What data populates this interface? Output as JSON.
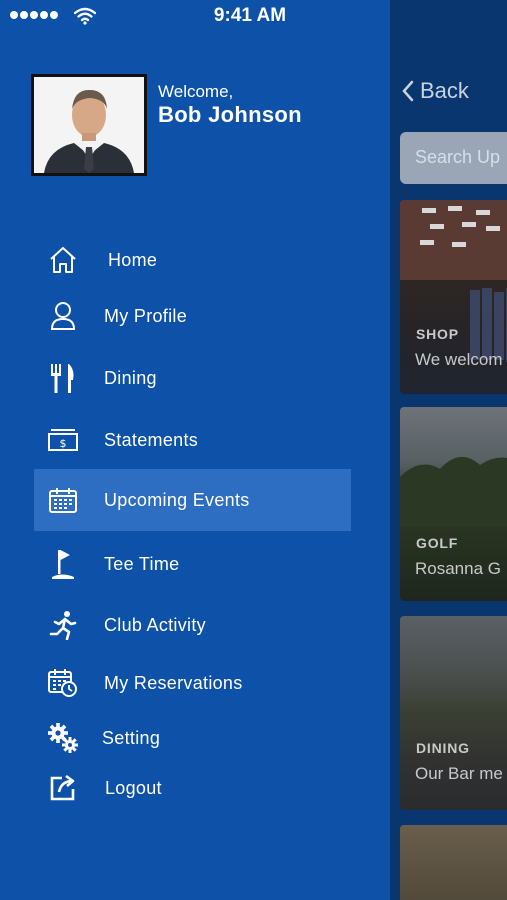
{
  "status_bar": {
    "time": "9:41 AM"
  },
  "profile": {
    "welcome": "Welcome,",
    "name": "Bob Johnson"
  },
  "menu": [
    {
      "label": "Home",
      "icon": "home-icon"
    },
    {
      "label": "My Profile",
      "icon": "user-icon"
    },
    {
      "label": "Dining",
      "icon": "fork-knife-icon"
    },
    {
      "label": "Statements",
      "icon": "bill-icon"
    },
    {
      "label": "Upcoming Events",
      "icon": "calendar-icon",
      "active": true
    },
    {
      "label": "Tee Time",
      "icon": "golf-flag-icon"
    },
    {
      "label": "Club Activity",
      "icon": "runner-icon"
    },
    {
      "label": "My Reservations",
      "icon": "calendar-clock-icon"
    },
    {
      "label": "Setting",
      "icon": "gears-icon"
    },
    {
      "label": "Logout",
      "icon": "logout-icon"
    }
  ],
  "main": {
    "back_label": "Back",
    "search_placeholder": "Search Up",
    "cards": [
      {
        "category": "SHOP",
        "description": "We welcom"
      },
      {
        "category": "GOLF",
        "description": "Rosanna G"
      },
      {
        "category": "DINING",
        "description": "Our Bar me"
      },
      {
        "category": "",
        "description": ""
      }
    ]
  },
  "colors": {
    "drawer": "#0d52a8",
    "active_item": "#2d6dc2",
    "main_bg": "#0a3670"
  }
}
